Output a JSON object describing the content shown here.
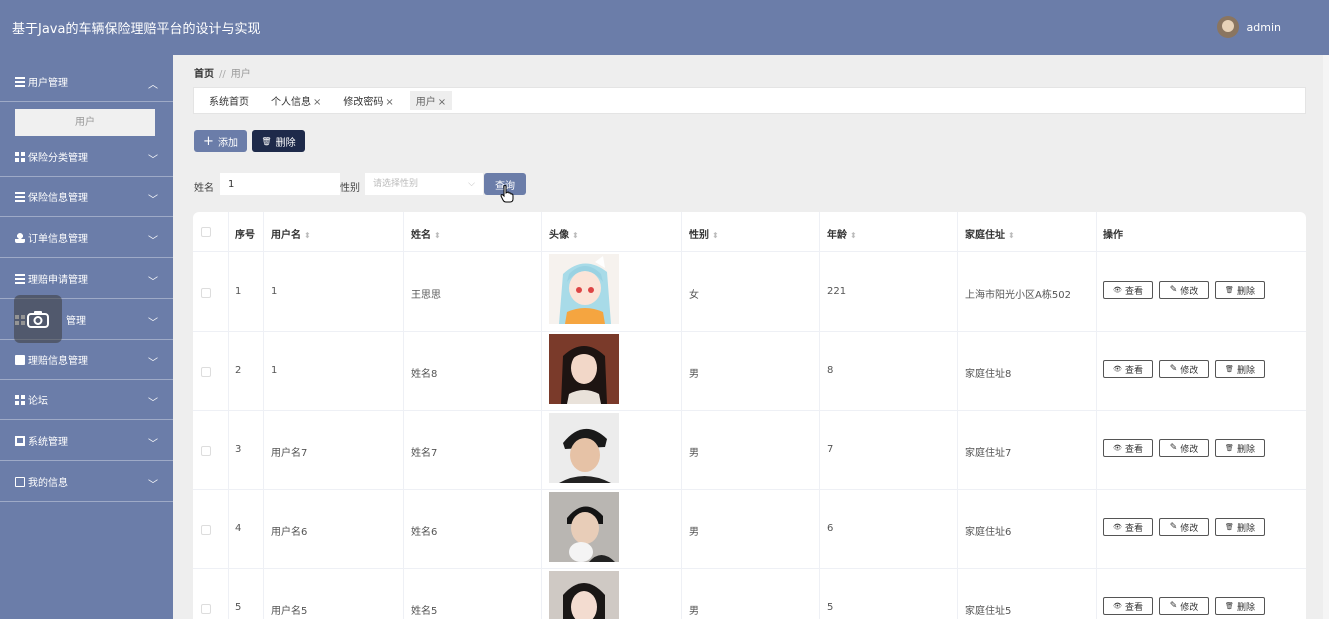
{
  "header": {
    "title": "基于Java的车辆保险理赔平台的设计与实现",
    "user_name": "admin"
  },
  "sidebar": {
    "items": [
      {
        "label": "用户管理",
        "icon": "list-icon",
        "chevron": "up"
      },
      {
        "label": "保险分类管理",
        "icon": "grid-icon",
        "chevron": "down"
      },
      {
        "label": "保险信息管理",
        "icon": "sliders-icon",
        "chevron": "down"
      },
      {
        "label": "订单信息管理",
        "icon": "user-icon",
        "chevron": "down"
      },
      {
        "label": "理赔申请管理",
        "icon": "list-icon",
        "chevron": "down"
      },
      {
        "label": "理赔信息管理",
        "icon": "grid-icon",
        "chevron": "down"
      },
      {
        "label": "理赔信息管理",
        "icon": "clipboard-icon",
        "chevron": "down"
      },
      {
        "label": "论坛",
        "icon": "grid-icon",
        "chevron": "down"
      },
      {
        "label": "系统管理",
        "icon": "monitor-icon",
        "chevron": "down"
      },
      {
        "label": "我的信息",
        "icon": "card-icon",
        "chevron": "down"
      }
    ],
    "sub_item": "用户",
    "item5_partial": "管理"
  },
  "breadcrumb": {
    "home": "首页",
    "sep": "//",
    "current": "用户"
  },
  "tabs": [
    {
      "label": "系统首页",
      "closable": false
    },
    {
      "label": "个人信息",
      "closable": true
    },
    {
      "label": "修改密码",
      "closable": true
    },
    {
      "label": "用户",
      "closable": true
    }
  ],
  "tab_close": "×",
  "actions": {
    "add": "添加",
    "add_icon": "+",
    "delete": "删除",
    "delete_icon": "🗑"
  },
  "search": {
    "name_label": "姓名",
    "name_value": "1",
    "gender_label": "性别",
    "gender_placeholder": "请选择性别",
    "select_arrow": "⌵",
    "query": "查询"
  },
  "table": {
    "headers": [
      "序号",
      "用户名",
      "姓名",
      "头像",
      "性别",
      "年龄",
      "家庭住址",
      "操作"
    ],
    "sort_icon": "⬍",
    "rows": [
      {
        "index": "1",
        "username": "1",
        "name": "王思思",
        "gender": "女",
        "age": "221",
        "address": "上海市阳光小区A栋502",
        "photo": "anime"
      },
      {
        "index": "2",
        "username": "1",
        "name": "姓名8",
        "gender": "男",
        "age": "8",
        "address": "家庭住址8",
        "photo": "girl"
      },
      {
        "index": "3",
        "username": "用户名7",
        "name": "姓名7",
        "gender": "男",
        "age": "7",
        "address": "家庭住址7",
        "photo": "boy-cap"
      },
      {
        "index": "4",
        "username": "用户名6",
        "name": "姓名6",
        "gender": "男",
        "age": "6",
        "address": "家庭住址6",
        "photo": "boy"
      },
      {
        "index": "5",
        "username": "用户名5",
        "name": "姓名5",
        "gender": "男",
        "age": "5",
        "address": "家庭住址5",
        "photo": "girl2"
      }
    ],
    "ops": {
      "view": "查看",
      "edit": "修改",
      "delete": "删除",
      "view_icon": "👁",
      "edit_icon": "✎",
      "delete_icon": "🗑"
    }
  }
}
